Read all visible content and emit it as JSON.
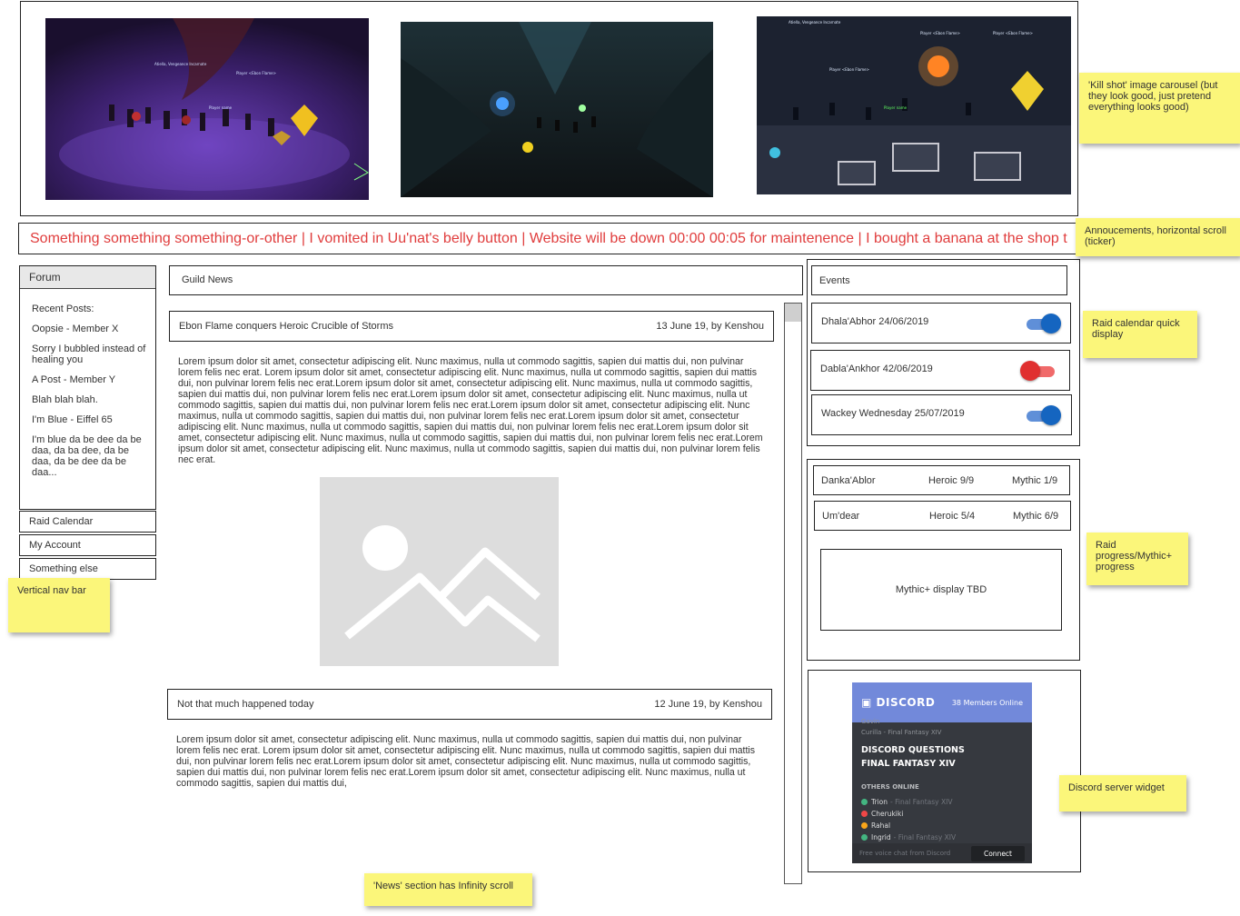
{
  "ticker": {
    "text": "Something something something-or-other | I vomited in Uu'nat's belly button | Website will be down 00:00 00:05 for maintenence | I bought a banana at the shop t"
  },
  "nav": {
    "header": "Forum",
    "recent_title": "Recent Posts:",
    "posts": [
      "Oopsie - Member X",
      "Sorry I bubbled instead of healing you",
      "A Post - Member Y",
      "Blah blah blah.",
      "I'm Blue - Eiffel 65",
      "I'm blue da be dee da be daa, da ba dee, da be daa, da be dee da be daa..."
    ],
    "items": [
      "Raid Calendar",
      "My Account",
      "Something else"
    ]
  },
  "news": {
    "title": "Guild News",
    "articles": [
      {
        "title": "Ebon Flame conquers Heroic Crucible of Storms",
        "meta": "13 June 19, by Kenshou",
        "body": "Lorem ipsum dolor sit amet, consectetur adipiscing elit. Nunc maximus, nulla ut commodo sagittis, sapien dui mattis dui, non pulvinar lorem felis nec erat. Lorem ipsum dolor sit amet, consectetur adipiscing elit. Nunc maximus, nulla ut commodo sagittis, sapien dui mattis dui, non pulvinar lorem felis nec erat.Lorem ipsum dolor sit amet, consectetur adipiscing elit. Nunc maximus, nulla ut commodo sagittis, sapien dui mattis dui, non pulvinar lorem felis nec erat.Lorem ipsum dolor sit amet, consectetur adipiscing elit. Nunc maximus, nulla ut commodo sagittis, sapien dui mattis dui, non pulvinar lorem felis nec erat.Lorem ipsum dolor sit amet, consectetur adipiscing elit. Nunc maximus, nulla ut commodo sagittis, sapien dui mattis dui, non pulvinar lorem felis nec erat.Lorem ipsum dolor sit amet, consectetur adipiscing elit. Nunc maximus, nulla ut commodo sagittis, sapien dui mattis dui, non pulvinar lorem felis nec erat.Lorem ipsum dolor sit amet, consectetur adipiscing elit. Nunc maximus, nulla ut commodo sagittis, sapien dui mattis dui, non pulvinar lorem felis nec erat.Lorem ipsum dolor sit amet, consectetur adipiscing elit. Nunc maximus, nulla ut commodo sagittis, sapien dui mattis dui, non pulvinar lorem felis nec erat."
      },
      {
        "title": "Not that much happened today",
        "meta": "12 June 19, by Kenshou",
        "body": "Lorem ipsum dolor sit amet, consectetur adipiscing elit. Nunc maximus, nulla ut commodo sagittis, sapien dui mattis dui, non pulvinar lorem felis nec erat. Lorem ipsum dolor sit amet, consectetur adipiscing elit. Nunc maximus, nulla ut commodo sagittis, sapien dui mattis dui, non pulvinar lorem felis nec erat.Lorem ipsum dolor sit amet, consectetur adipiscing elit. Nunc maximus, nulla ut commodo sagittis, sapien dui mattis dui, non pulvinar lorem felis nec erat.Lorem ipsum dolor sit amet, consectetur adipiscing elit. Nunc maximus, nulla ut commodo sagittis, sapien dui mattis dui,"
      }
    ]
  },
  "events": {
    "title": "Events",
    "items": [
      {
        "label": "Dhala'Abhor 24/06/2019",
        "enabled": true
      },
      {
        "label": "Dabla'Ankhor 42/06/2019",
        "enabled": false
      },
      {
        "label": "Wackey Wednesday 25/07/2019",
        "enabled": true
      }
    ]
  },
  "progress": {
    "rows": [
      {
        "raid": "Danka'Ablor",
        "heroic": "Heroic 9/9",
        "mythic": "Mythic 1/9"
      },
      {
        "raid": "Um'dear",
        "heroic": "Heroic 5/4",
        "mythic": "Mythic 6/9"
      }
    ],
    "mythic_plus": "Mythic+ display TBD"
  },
  "discord": {
    "logo": "DISCORD",
    "online": "38 Members Online",
    "top_members": [
      "Gavin",
      "Curilla - Final Fantasy XIV"
    ],
    "channel_title": "DISCORD QUESTIONS",
    "channel_sub": "FINAL FANTASY XIV",
    "section": "OTHERS ONLINE",
    "members": [
      {
        "name": "Trion",
        "game": "- Final Fantasy XIV"
      },
      {
        "name": "Cherukiki",
        "game": ""
      },
      {
        "name": "Rahal",
        "game": ""
      },
      {
        "name": "Ingrid",
        "game": "- Final Fantasy XIV"
      }
    ],
    "footer": "Free voice chat from Discord",
    "connect": "Connect",
    "colors": {
      "header": "#7289da",
      "body": "#36393f"
    }
  },
  "notes": {
    "carousel": "'Kill shot' image carousel (but they look good, just pretend everything looks good)",
    "ticker": "Annoucements, horizontal scroll (ticker)",
    "nav": "Vertical nav bar",
    "calendar": "Raid calendar quick display",
    "progress": "Raid progress/Mythic+ progress",
    "discord": "Discord server widget",
    "news": "'News' section has Infinity scroll"
  },
  "colors": {
    "ticker_text": "#e03c3c",
    "sticky": "#fbf67a",
    "toggle_on": "#1565c0",
    "toggle_off": "#e03030"
  }
}
